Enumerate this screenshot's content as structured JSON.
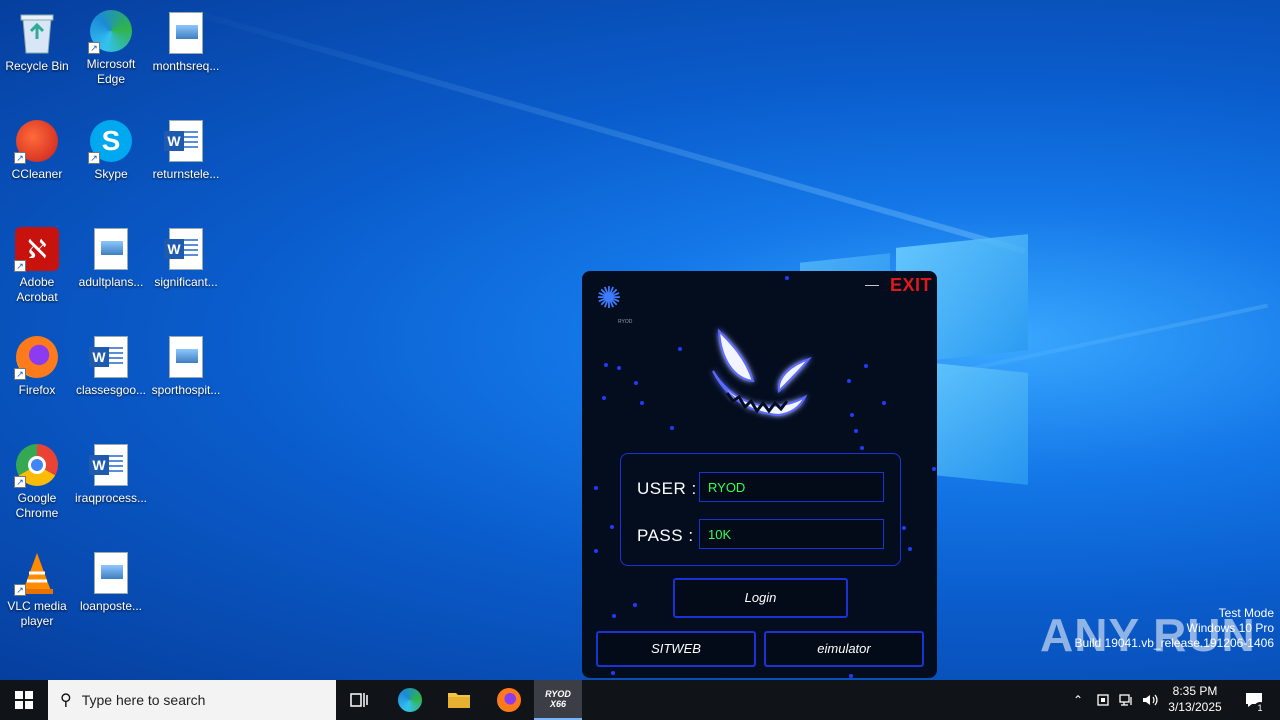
{
  "desktop": {
    "icons": [
      {
        "label": "Recycle Bin"
      },
      {
        "label": "Microsoft Edge"
      },
      {
        "label": "monthsreq..."
      },
      {
        "label": "CCleaner"
      },
      {
        "label": "Skype"
      },
      {
        "label": "returnstele..."
      },
      {
        "label": "Adobe Acrobat"
      },
      {
        "label": "adultplans..."
      },
      {
        "label": "significant..."
      },
      {
        "label": "Firefox"
      },
      {
        "label": "classesgoo..."
      },
      {
        "label": "sporthospit..."
      },
      {
        "label": "Google Chrome"
      },
      {
        "label": "iraqprocess..."
      },
      {
        "label": "VLC media player"
      },
      {
        "label": "loanposte..."
      }
    ]
  },
  "app": {
    "minimize_label": "—",
    "exit_label": "EXIT",
    "logo_caption": "RYOD",
    "user_label": "USER :",
    "user_value": "RYOD",
    "pass_label": "PASS :",
    "pass_value": "10K",
    "login_label": "Login",
    "sitweb_label": "SITWEB",
    "emulator_label": "eimulator"
  },
  "watermark": {
    "brand": "ANY RUN",
    "line1": "Test Mode",
    "line2": "Windows 10 Pro",
    "line3": "Build 19041.vb_release.191206-1406"
  },
  "taskbar": {
    "search_placeholder": "Type here to search",
    "active_app_label": "RYOD X66",
    "time": "8:35 PM",
    "date": "3/13/2025",
    "notification_count": "1"
  }
}
